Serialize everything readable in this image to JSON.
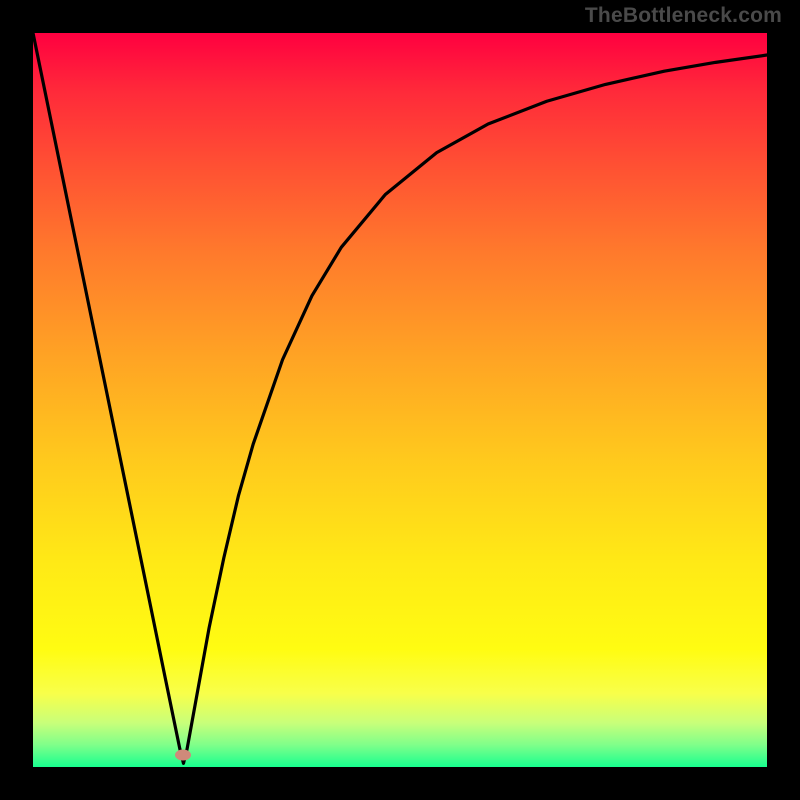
{
  "watermark": "TheBottleneck.com",
  "colors": {
    "curve": "#000000",
    "marker": "#cf8a7a",
    "frame": "#000000"
  },
  "chart_data": {
    "type": "line",
    "title": "",
    "xlabel": "",
    "ylabel": "",
    "xlim": [
      0,
      100
    ],
    "ylim": [
      0,
      100
    ],
    "x": [
      0,
      4,
      8,
      12,
      16,
      18,
      20,
      20.5,
      21,
      22,
      24,
      26,
      28,
      30,
      34,
      38,
      42,
      48,
      55,
      62,
      70,
      78,
      86,
      93,
      100
    ],
    "series": [
      {
        "name": "bottleneck-curve",
        "values": [
          100,
          80.5,
          61,
          41.5,
          22,
          12.2,
          2.5,
          0.5,
          2.5,
          8,
          19,
          28.5,
          37,
          44,
          55.5,
          64.2,
          70.8,
          78,
          83.7,
          87.6,
          90.7,
          93,
          94.8,
          96,
          97
        ]
      }
    ],
    "marker": {
      "x": 20.5,
      "y": 1.7
    },
    "grid": false,
    "legend": false
  }
}
